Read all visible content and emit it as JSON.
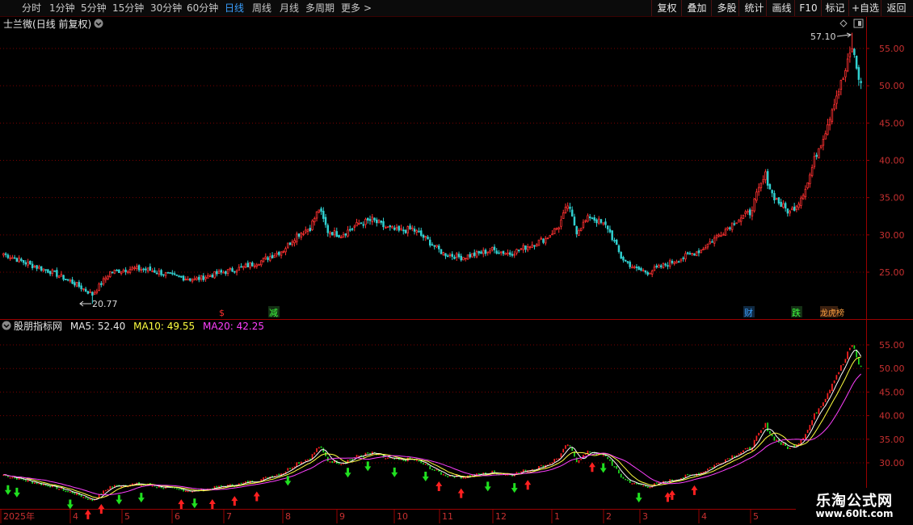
{
  "toolbar": {
    "periods": [
      "分时",
      "1分钟",
      "5分钟",
      "15分钟",
      "30分钟",
      "60分钟",
      "日线",
      "周线",
      "月线",
      "多周期",
      "更多"
    ],
    "active_period": "日线",
    "more_arrow": ">",
    "right_buttons": [
      "复权",
      "叠加",
      "多股",
      "统计",
      "画线",
      "F10",
      "标记",
      "+自选",
      "返回"
    ]
  },
  "main_panel": {
    "stock_name": "士兰微",
    "mode": "(日线 前复权)",
    "high_label": "57.10",
    "low_label": "20.77",
    "price_ticks": [
      "55.00",
      "50.00",
      "45.00",
      "40.00",
      "35.00",
      "30.00",
      "25.00"
    ],
    "event_markers": [
      {
        "text": "$",
        "color": "#ff3030",
        "box": false
      },
      {
        "text": "减",
        "color": "#40ff40",
        "box": true
      },
      {
        "text": "财",
        "color": "#3aa0ff",
        "box": true
      },
      {
        "text": "跌",
        "color": "#40ff40",
        "box": true
      },
      {
        "text": "龙虎榜",
        "color": "#ffa040",
        "box": true
      }
    ]
  },
  "indicator_panel": {
    "name": "股朋指标网",
    "ma5_label": "MA5: 52.40",
    "ma10_label": "MA10: 49.55",
    "ma20_label": "MA20: 42.25",
    "ma5_color": "#ffffff",
    "ma10_color": "#ffff40",
    "ma20_color": "#ff40ff",
    "ticks": [
      "55.00",
      "50.00",
      "45.00",
      "40.00",
      "35.00",
      "30.00"
    ]
  },
  "x_axis": {
    "labels": [
      "2025年",
      "4",
      "5",
      "6",
      "7",
      "8",
      "9",
      "10",
      "11",
      "12",
      "1",
      "2",
      "3",
      "4",
      "5"
    ]
  },
  "watermark": {
    "line1": "乐淘公式网",
    "line2": "www.60lt.com"
  },
  "colors": {
    "up": "#ff3030",
    "down": "#30d0d0",
    "grid": "#7a0000",
    "bg": "#000000"
  },
  "chart_data": {
    "type": "candlestick",
    "high": 57.1,
    "low": 20.77,
    "ylim": [
      20,
      58
    ],
    "ma_current": {
      "MA5": 52.4,
      "MA10": 49.55,
      "MA20": 42.25
    },
    "close_keypoints": [
      [
        0,
        27.5
      ],
      [
        12,
        26
      ],
      [
        22,
        25
      ],
      [
        32,
        23.5
      ],
      [
        40,
        22
      ],
      [
        48,
        25
      ],
      [
        58,
        25.5
      ],
      [
        66,
        25.3
      ],
      [
        76,
        24.5
      ],
      [
        86,
        24
      ],
      [
        96,
        24.8
      ],
      [
        106,
        25.5
      ],
      [
        116,
        26.5
      ],
      [
        126,
        28
      ],
      [
        132,
        30
      ],
      [
        138,
        31
      ],
      [
        142,
        33.5
      ],
      [
        146,
        30.5
      ],
      [
        152,
        30
      ],
      [
        160,
        31.5
      ],
      [
        166,
        32
      ],
      [
        172,
        31
      ],
      [
        178,
        30.5
      ],
      [
        184,
        30.8
      ],
      [
        190,
        29.5
      ],
      [
        198,
        27.5
      ],
      [
        206,
        27
      ],
      [
        214,
        27.5
      ],
      [
        220,
        28
      ],
      [
        228,
        27.5
      ],
      [
        236,
        28.5
      ],
      [
        244,
        29.5
      ],
      [
        250,
        31.2
      ],
      [
        254,
        34
      ],
      [
        258,
        30.5
      ],
      [
        264,
        32.5
      ],
      [
        272,
        31
      ],
      [
        278,
        27
      ],
      [
        284,
        25.5
      ],
      [
        290,
        25
      ],
      [
        298,
        26
      ],
      [
        306,
        27
      ],
      [
        314,
        28
      ],
      [
        322,
        30
      ],
      [
        330,
        32
      ],
      [
        336,
        33
      ],
      [
        340,
        36
      ],
      [
        343,
        38
      ],
      [
        346,
        35.5
      ],
      [
        350,
        34
      ],
      [
        354,
        33
      ],
      [
        358,
        34.5
      ],
      [
        362,
        37
      ],
      [
        366,
        41
      ],
      [
        370,
        44
      ],
      [
        374,
        48
      ],
      [
        378,
        51
      ],
      [
        380,
        53
      ],
      [
        382,
        55.2
      ],
      [
        384,
        52.4
      ],
      [
        386,
        50
      ]
    ]
  }
}
